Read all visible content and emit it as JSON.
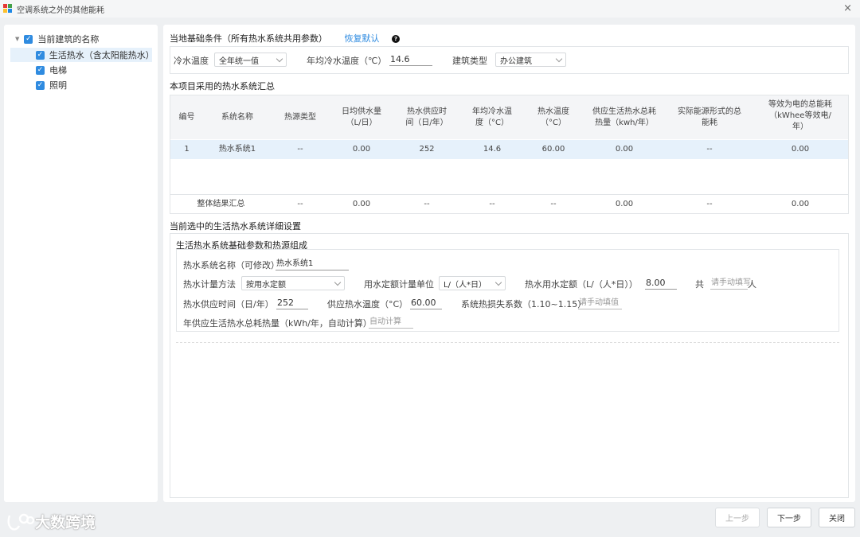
{
  "window": {
    "title": "空调系统之外的其他能耗",
    "close_icon": "×"
  },
  "tree": {
    "root": "当前建筑的名称",
    "items": [
      {
        "label": "生活热水（含太阳能热水）",
        "selected": true
      },
      {
        "label": "电梯"
      },
      {
        "label": "照明"
      }
    ]
  },
  "basic": {
    "title": "当地基础条件（所有热水系统共用参数）",
    "restore_label": "恢复默认",
    "help_icon": "?",
    "cold_water_temp_label": "冷水温度",
    "cold_water_temp_value": "全年统一值",
    "annual_cold_temp_label": "年均冷水温度（℃）",
    "annual_cold_temp_value": "14.6",
    "building_type_label": "建筑类型",
    "building_type_value": "办公建筑"
  },
  "summary": {
    "title": "本项目采用的热水系统汇总",
    "headers": [
      "编号",
      "系统名称",
      "热源类型",
      "日均供水量\n（L/日）",
      "热水供应时\n间（日/年）",
      "年均冷水温\n度（°C）",
      "热水温度\n（°C）",
      "供应生活热水总耗\n热量（kwh/年）",
      "实际能源形式的总\n能耗",
      "等效为电的总能耗\n（kWhee等效电/\n年）"
    ],
    "rows": [
      [
        "1",
        "热水系统1",
        "--",
        "0.00",
        "252",
        "14.6",
        "60.00",
        "0.00",
        "--",
        "0.00"
      ]
    ],
    "total_row": [
      "整体结果汇总",
      "--",
      "0.00",
      "--",
      "--",
      "--",
      "0.00",
      "--",
      "0.00"
    ]
  },
  "detail": {
    "title": "当前选中的生活热水系统详细设置",
    "subtitle": "生活热水系统基础参数和热源组成",
    "name_label": "热水系统名称（可修改）",
    "name_value": "热水系统1",
    "meter_method_label": "热水计量方法",
    "meter_method_value": "按用水定额",
    "quota_unit_label": "用水定额计量单位",
    "quota_unit_value": "L/（人*日）",
    "quota_label": "热水用水定额（L/（人*日））",
    "quota_value": "8.00",
    "total_label": "共",
    "people_placeholder": "请手动填写",
    "people_unit": "人",
    "supply_time_label": "热水供应时间（日/年）",
    "supply_time_value": "252",
    "supply_temp_label": "供应热水温度（°C）",
    "supply_temp_value": "60.00",
    "loss_coef_label": "系统热损失系数（1.10~1.15）",
    "loss_coef_placeholder": "请手动填值",
    "annual_heat_label": "年供应生活热水总耗热量（kWh/年，自动计算）",
    "annual_heat_placeholder": "自动计算"
  },
  "footer": {
    "watermark": "大数跨境",
    "prev_label": "上一步",
    "next_label": "下一步",
    "close_label": "关闭"
  }
}
